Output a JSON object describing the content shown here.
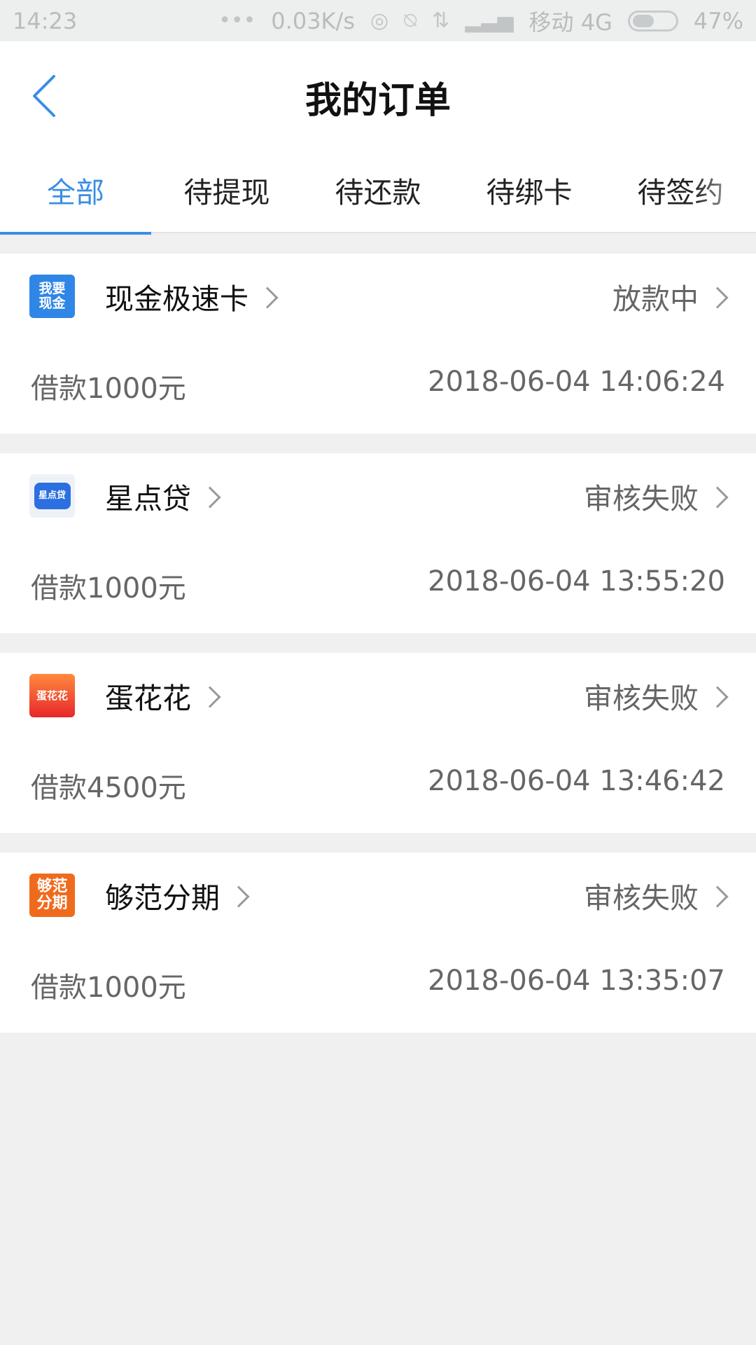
{
  "status_bar": {
    "time": "14:23",
    "network_speed": "0.03K/s",
    "carrier": "移动 4G",
    "battery": "47%"
  },
  "header": {
    "title": "我的订单",
    "back_icon": "back-arrow-icon"
  },
  "tabs": [
    {
      "label": "全部",
      "active": true
    },
    {
      "label": "待提现",
      "active": false
    },
    {
      "label": "待还款",
      "active": false
    },
    {
      "label": "待绑卡",
      "active": false
    },
    {
      "label": "待签约",
      "active": false
    }
  ],
  "orders": [
    {
      "logo_text": "我要\n现金",
      "name": "现金极速卡",
      "status": "放款中",
      "amount": "借款1000元",
      "time": "2018-06-04 14:06:24",
      "logo_color": "#2f86e6"
    },
    {
      "logo_text": "星点贷",
      "name": "星点贷",
      "status": "审核失败",
      "amount": "借款1000元",
      "time": "2018-06-04 13:55:20",
      "logo_color": "#2b6fe0"
    },
    {
      "logo_text": "蛋花花",
      "name": "蛋花花",
      "status": "审核失败",
      "amount": "借款4500元",
      "time": "2018-06-04 13:46:42",
      "logo_color": "#f2452f"
    },
    {
      "logo_text": "够范\n分期",
      "name": "够范分期",
      "status": "审核失败",
      "amount": "借款1000元",
      "time": "2018-06-04 13:35:07",
      "logo_color": "#f06a1d"
    }
  ],
  "colors": {
    "accent": "#3a8ee6",
    "text_primary": "#111111",
    "text_secondary": "#666666",
    "background": "#f0f0f0"
  }
}
